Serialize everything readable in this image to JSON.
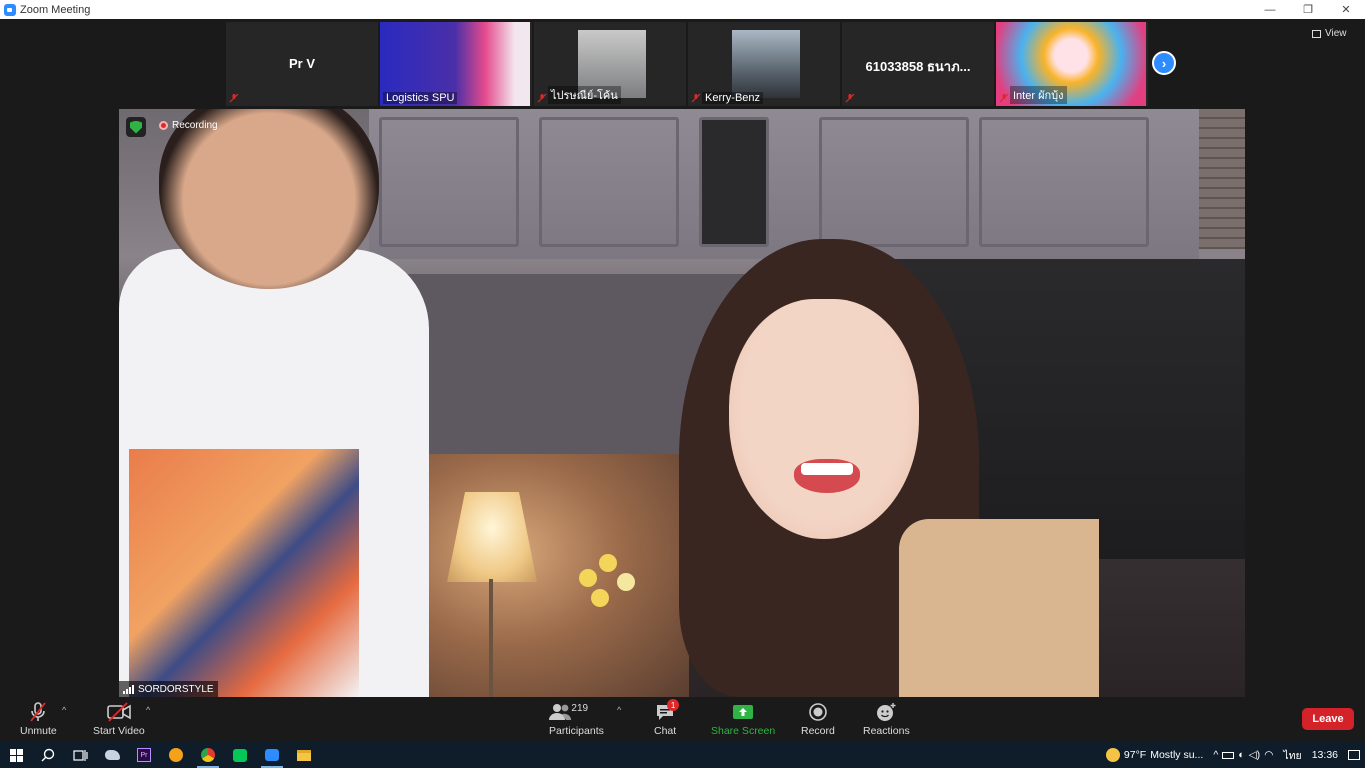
{
  "window": {
    "title": "Zoom Meeting",
    "controls": [
      "—",
      "❐",
      "✕"
    ]
  },
  "thumbnails": [
    {
      "type": "name",
      "name": "Pr V",
      "label": ""
    },
    {
      "type": "video",
      "name": "",
      "label": "Logistics SPU"
    },
    {
      "type": "video",
      "name": "",
      "label": "ไปรษณีย์-โค้น"
    },
    {
      "type": "video",
      "name": "",
      "label": "Kerry-Benz"
    },
    {
      "type": "name",
      "name": "61033858 ธนาภ...",
      "label": ""
    },
    {
      "type": "video",
      "name": "",
      "label": "Inter ผักบุ้ง"
    }
  ],
  "view_label": "View",
  "speaker": {
    "recording_label": "Recording",
    "name": "SORDORSTYLE"
  },
  "toolbar": {
    "unmute": "Unmute",
    "start_video": "Start Video",
    "participants": "Participants",
    "participants_count": "219",
    "chat": "Chat",
    "chat_badge": "1",
    "share_screen": "Share Screen",
    "record": "Record",
    "reactions": "Reactions",
    "leave": "Leave"
  },
  "taskbar": {
    "weather_temp": "97°F",
    "weather_text": "Mostly su...",
    "lang": "ไทย",
    "time": "13:36"
  },
  "colors": {
    "accent": "#2d8cff",
    "share_green": "#2fb344",
    "leave_red": "#d3222a",
    "rec_red": "#e02828"
  }
}
